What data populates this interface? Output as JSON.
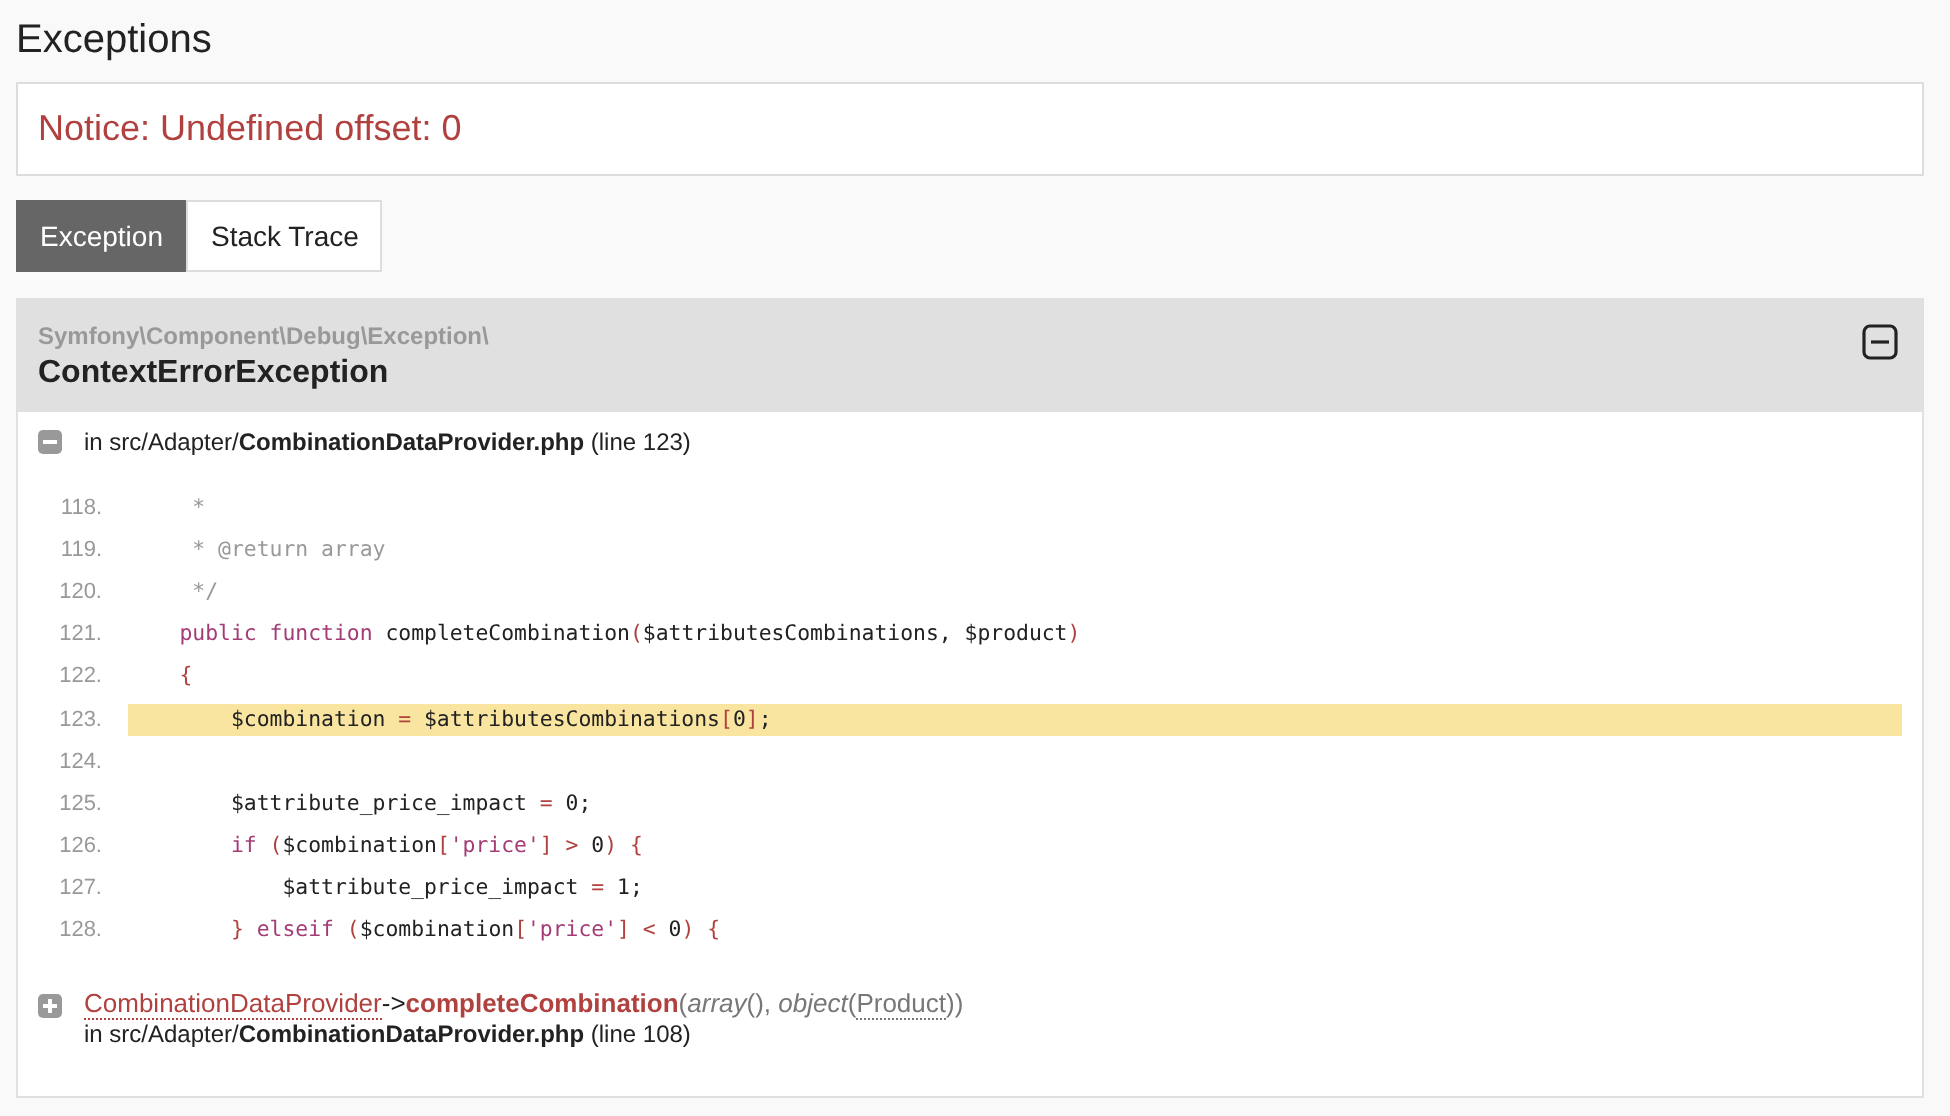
{
  "page_title": "Exceptions",
  "notice": "Notice: Undefined offset: 0",
  "tabs": [
    {
      "label": "Exception",
      "selected": true
    },
    {
      "label": "Stack Trace",
      "selected": false
    }
  ],
  "exception": {
    "namespace": "Symfony\\Component\\Debug\\Exception\\",
    "class": "ContextErrorException",
    "expanded": true,
    "location": "in src/Adapter/**CombinationDataProvider.php** (line 123)",
    "code": [
      {
        "number": "118.",
        "highlighted": false,
        "tokens": [
          {
            "kind": "comment",
            "text": "     *"
          }
        ]
      },
      {
        "number": "119.",
        "highlighted": false,
        "tokens": [
          {
            "kind": "comment",
            "text": "     * @return array"
          }
        ]
      },
      {
        "number": "120.",
        "highlighted": false,
        "tokens": [
          {
            "kind": "comment",
            "text": "     */"
          }
        ]
      },
      {
        "number": "121.",
        "highlighted": false,
        "tokens": [
          {
            "kind": "keyword",
            "text": "    public function"
          },
          {
            "kind": "plain",
            "text": " completeCombination"
          },
          {
            "kind": "punct",
            "text": "("
          },
          {
            "kind": "plain",
            "text": "$attributesCombinations, $product"
          },
          {
            "kind": "punct",
            "text": ")"
          }
        ]
      },
      {
        "number": "122.",
        "highlighted": false,
        "tokens": [
          {
            "kind": "punct",
            "text": "    {"
          }
        ]
      },
      {
        "number": "123.",
        "highlighted": true,
        "tokens": [
          {
            "kind": "plain",
            "text": "        $combination "
          },
          {
            "kind": "punct",
            "text": "="
          },
          {
            "kind": "plain",
            "text": " $attributesCombinations"
          },
          {
            "kind": "punct",
            "text": "["
          },
          {
            "kind": "plain",
            "text": "0"
          },
          {
            "kind": "punct",
            "text": "]"
          },
          {
            "kind": "plain",
            "text": ";"
          }
        ]
      },
      {
        "number": "124.",
        "highlighted": false
      },
      {
        "number": "125.",
        "highlighted": false,
        "tokens": [
          {
            "kind": "plain",
            "text": "        $attribute_price_impact "
          },
          {
            "kind": "punct",
            "text": "="
          },
          {
            "kind": "plain",
            "text": " 0;"
          }
        ]
      },
      {
        "number": "126.",
        "highlighted": false,
        "tokens": [
          {
            "kind": "keyword",
            "text": "        if "
          },
          {
            "kind": "punct",
            "text": "("
          },
          {
            "kind": "plain",
            "text": "$combination"
          },
          {
            "kind": "punct",
            "text": "["
          },
          {
            "kind": "string",
            "text": "'price'"
          },
          {
            "kind": "punct",
            "text": "] > "
          },
          {
            "kind": "plain",
            "text": "0"
          },
          {
            "kind": "punct",
            "text": ") {"
          }
        ]
      },
      {
        "number": "127.",
        "highlighted": false,
        "tokens": [
          {
            "kind": "plain",
            "text": "            $attribute_price_impact "
          },
          {
            "kind": "punct",
            "text": "="
          },
          {
            "kind": "plain",
            "text": " 1;"
          }
        ]
      },
      {
        "number": "128.",
        "highlighted": false,
        "tokens": [
          {
            "kind": "punct",
            "text": "        } "
          },
          {
            "kind": "keyword",
            "text": "elseif "
          },
          {
            "kind": "punct",
            "text": "("
          },
          {
            "kind": "plain",
            "text": "$combination"
          },
          {
            "kind": "punct",
            "text": "["
          },
          {
            "kind": "string",
            "text": "'price'"
          },
          {
            "kind": "punct",
            "text": "] < "
          },
          {
            "kind": "plain",
            "text": "0"
          },
          {
            "kind": "punct",
            "text": ") {"
          }
        ]
      }
    ]
  },
  "trace": [
    {
      "expanded": false,
      "class": "CombinationDataProvider",
      "arrow": "->",
      "method": "completeCombination",
      "args_before": "(*array*(), *object*(",
      "arg_class": "Product",
      "args_after": "))",
      "location": "in src/Adapter/**CombinationDataProvider.php** (line 108)"
    }
  ]
}
